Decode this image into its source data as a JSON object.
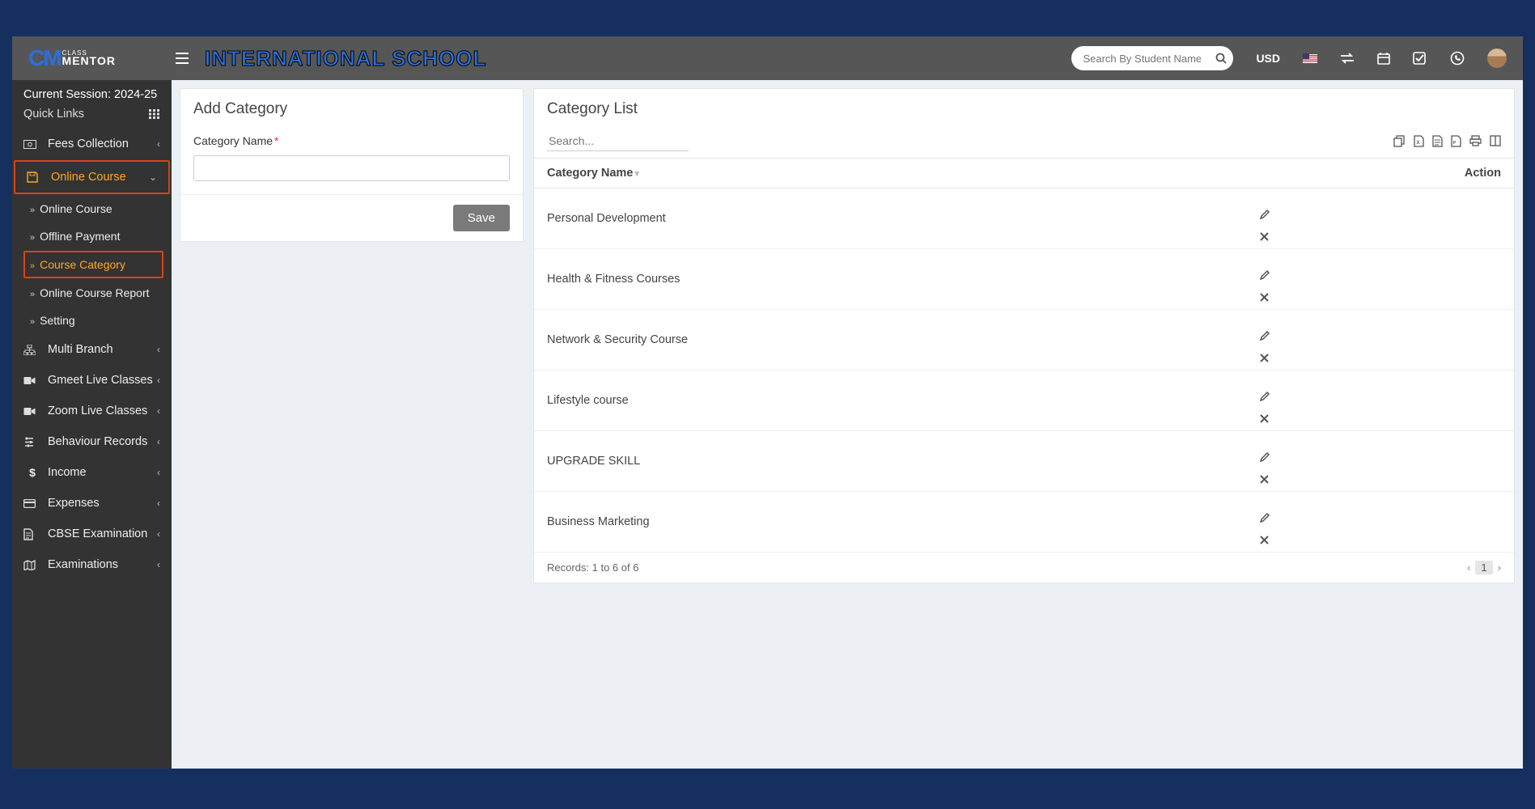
{
  "header": {
    "school_title": "INTERNATIONAL SCHOOL",
    "search_placeholder": "Search By Student Name",
    "currency": "USD"
  },
  "sidebar": {
    "session_label": "Current Session: 2024-25",
    "quick_links_label": "Quick Links",
    "items": [
      {
        "icon": "money",
        "label": "Fees Collection",
        "expandable": true
      },
      {
        "icon": "floppy",
        "label": "Online Course",
        "expandable": true,
        "active": true
      },
      {
        "icon": "sitemap",
        "label": "Multi Branch",
        "expandable": true
      },
      {
        "icon": "video",
        "label": "Gmeet Live Classes",
        "expandable": true
      },
      {
        "icon": "video",
        "label": "Zoom Live Classes",
        "expandable": true
      },
      {
        "icon": "sliders",
        "label": "Behaviour Records",
        "expandable": true
      },
      {
        "icon": "dollar",
        "label": "Income",
        "expandable": true
      },
      {
        "icon": "card",
        "label": "Expenses",
        "expandable": true
      },
      {
        "icon": "file",
        "label": "CBSE Examination",
        "expandable": true
      },
      {
        "icon": "map",
        "label": "Examinations",
        "expandable": true
      }
    ],
    "sub_items": [
      {
        "label": "Online Course"
      },
      {
        "label": "Offline Payment"
      },
      {
        "label": "Course Category",
        "active": true
      },
      {
        "label": "Online Course Report"
      },
      {
        "label": "Setting"
      }
    ]
  },
  "form": {
    "title": "Add Category",
    "label": "Category Name",
    "value": "",
    "save_label": "Save"
  },
  "list": {
    "title": "Category List",
    "search_placeholder": "Search...",
    "col_name": "Category Name",
    "col_action": "Action",
    "rows": [
      {
        "name": "Personal Development"
      },
      {
        "name": "Health & Fitness Courses"
      },
      {
        "name": "Network & Security Course"
      },
      {
        "name": "Lifestyle course"
      },
      {
        "name": "UPGRADE SKILL"
      },
      {
        "name": "Business Marketing"
      }
    ],
    "records_text": "Records: 1 to 6 of 6",
    "page_current": "1"
  }
}
